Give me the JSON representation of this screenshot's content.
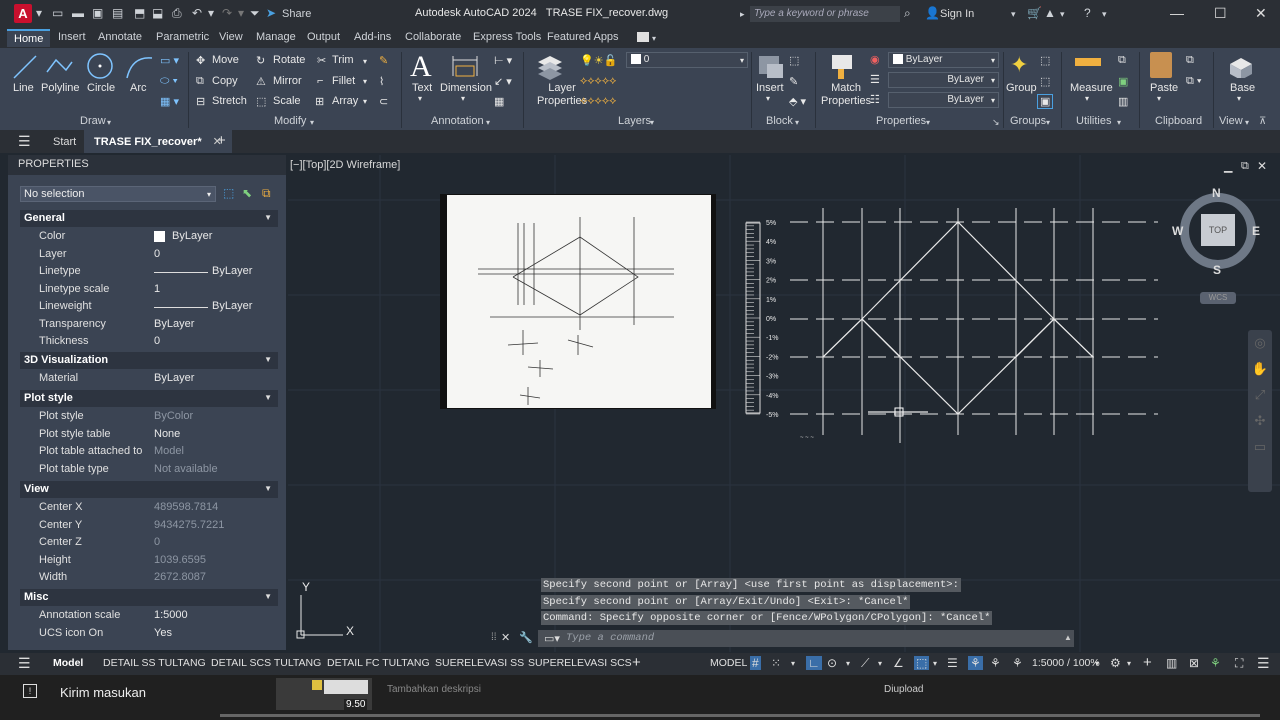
{
  "title_bar": {
    "app_title": "Autodesk AutoCAD 2024",
    "file_title": "TRASE FIX_recover.dwg",
    "share_label": "Share",
    "search_placeholder": "Type a keyword or phrase",
    "signin_label": "Sign In"
  },
  "ribbon_tabs": [
    "Home",
    "Insert",
    "Annotate",
    "Parametric",
    "View",
    "Manage",
    "Output",
    "Add-ins",
    "Collaborate",
    "Express Tools",
    "Featured Apps"
  ],
  "ribbon": {
    "draw": {
      "line": "Line",
      "polyline": "Polyline",
      "circle": "Circle",
      "arc": "Arc",
      "title": "Draw"
    },
    "modify": {
      "move": "Move",
      "rotate": "Rotate",
      "trim": "Trim",
      "copy": "Copy",
      "mirror": "Mirror",
      "fillet": "Fillet",
      "stretch": "Stretch",
      "scale": "Scale",
      "array": "Array",
      "title": "Modify"
    },
    "annotation": {
      "text": "Text",
      "dimension": "Dimension",
      "title": "Annotation"
    },
    "layers": {
      "layer_properties": "Layer Properties",
      "current_layer": "0",
      "title": "Layers"
    },
    "block": {
      "insert": "Insert",
      "title": "Block"
    },
    "properties": {
      "match_properties": "Match Properties",
      "color": "ByLayer",
      "linetype": "ByLayer",
      "lineweight": "ByLayer",
      "title": "Properties"
    },
    "groups": {
      "group": "Group",
      "title": "Groups"
    },
    "utilities": {
      "measure": "Measure",
      "title": "Utilities"
    },
    "clipboard": {
      "paste": "Paste",
      "title": "Clipboard"
    },
    "view": {
      "base": "Base",
      "title": "View"
    }
  },
  "file_tabs": {
    "start": "Start",
    "active": "TRASE FIX_recover*"
  },
  "properties_palette": {
    "header": "PROPERTIES",
    "selection": "No selection",
    "general": {
      "title": "General",
      "rows": [
        {
          "k": "Color",
          "v": "ByLayer"
        },
        {
          "k": "Layer",
          "v": "0"
        },
        {
          "k": "Linetype",
          "v": "ByLayer"
        },
        {
          "k": "Linetype scale",
          "v": "1"
        },
        {
          "k": "Lineweight",
          "v": "ByLayer"
        },
        {
          "k": "Transparency",
          "v": "ByLayer"
        },
        {
          "k": "Thickness",
          "v": "0"
        }
      ]
    },
    "viz3d": {
      "title": "3D Visualization",
      "rows": [
        {
          "k": "Material",
          "v": "ByLayer"
        }
      ]
    },
    "plotstyle": {
      "title": "Plot style",
      "rows": [
        {
          "k": "Plot style",
          "v": "ByColor"
        },
        {
          "k": "Plot style table",
          "v": "None"
        },
        {
          "k": "Plot table attached to",
          "v": "Model"
        },
        {
          "k": "Plot table type",
          "v": "Not available"
        }
      ]
    },
    "view": {
      "title": "View",
      "rows": [
        {
          "k": "Center X",
          "v": "489598.7814"
        },
        {
          "k": "Center Y",
          "v": "9434275.7221"
        },
        {
          "k": "Center Z",
          "v": "0"
        },
        {
          "k": "Height",
          "v": "1039.6595"
        },
        {
          "k": "Width",
          "v": "2672.8087"
        }
      ]
    },
    "misc": {
      "title": "Misc",
      "rows": [
        {
          "k": "Annotation scale",
          "v": "1:5000"
        },
        {
          "k": "UCS icon On",
          "v": "Yes"
        }
      ]
    }
  },
  "viewport": {
    "label": "[−][Top][2D Wireframe]",
    "viewcube": {
      "top": "TOP",
      "n": "N",
      "s": "S",
      "e": "E",
      "w": "W",
      "ucs": "WCS"
    },
    "grade_labels": [
      "5%",
      "4%",
      "3%",
      "2%",
      "1%",
      "0%",
      "-1%",
      "-2%",
      "-3%",
      "-4%",
      "-5%"
    ],
    "ucs_x": "X",
    "ucs_y": "Y"
  },
  "command_line": {
    "history": [
      "Specify second point or [Array] <use first point as displacement>:",
      "Specify second point or [Array/Exit/Undo] <Exit>: *Cancel*",
      "Command: Specify opposite corner or [Fence/WPolygon/CPolygon]: *Cancel*"
    ],
    "placeholder": "Type a command"
  },
  "layout_tabs": [
    "Model",
    "DETAIL SS TULTANG",
    "DETAIL SCS TULTANG",
    "DETAIL FC TULTANG",
    "SUERELEVASI SS",
    "SUPERELEVASI SCS"
  ],
  "status_bar": {
    "model": "MODEL",
    "scale": "1:5000 / 100%"
  },
  "taskbar": {
    "feedback": "Kirim masukan",
    "description": "Tambahkan deskripsi",
    "upload": "Diupload",
    "time": "9.50"
  }
}
